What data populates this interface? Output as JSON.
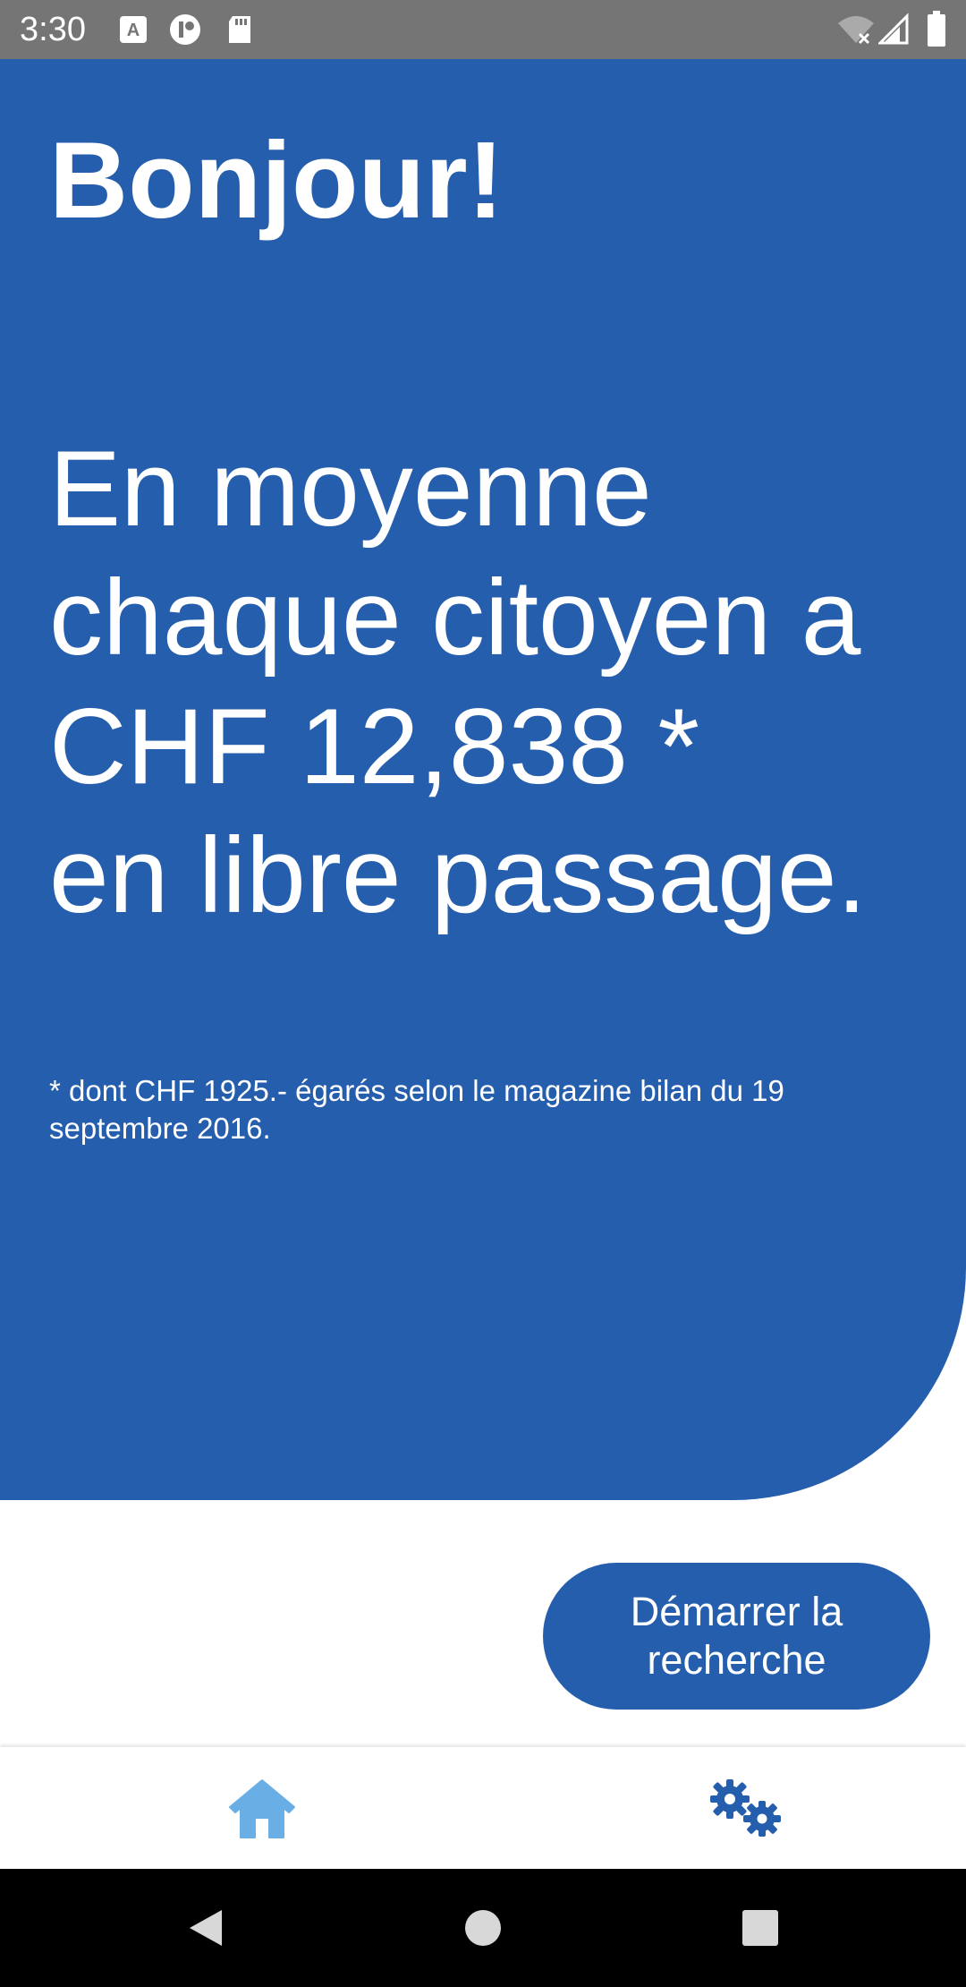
{
  "status_bar": {
    "time": "3:30",
    "icons": [
      "accessibility-a-icon",
      "circle-app-icon",
      "sd-card-icon",
      "wifi-off-icon",
      "signal-icon",
      "battery-icon"
    ]
  },
  "hero": {
    "title": "Bonjour!",
    "stat_lines": [
      "En moyenne",
      "chaque citoyen a",
      "CHF 12,838 *",
      "en libre passage."
    ],
    "footnote": "* dont CHF 1925.- égarés selon le magazine bilan du 19 septembre 2016."
  },
  "start_button": {
    "label": "Démarrer la recherche"
  },
  "bottom_nav": {
    "items": [
      {
        "icon": "home-icon",
        "active": true
      },
      {
        "icon": "gears-icon",
        "active": false
      }
    ]
  },
  "system_nav": {
    "icons": [
      "back-icon",
      "home-circle-icon",
      "recents-icon"
    ]
  },
  "colors": {
    "primary": "#255ead",
    "home_active": "#6aaee6",
    "status_bar": "#757575"
  }
}
